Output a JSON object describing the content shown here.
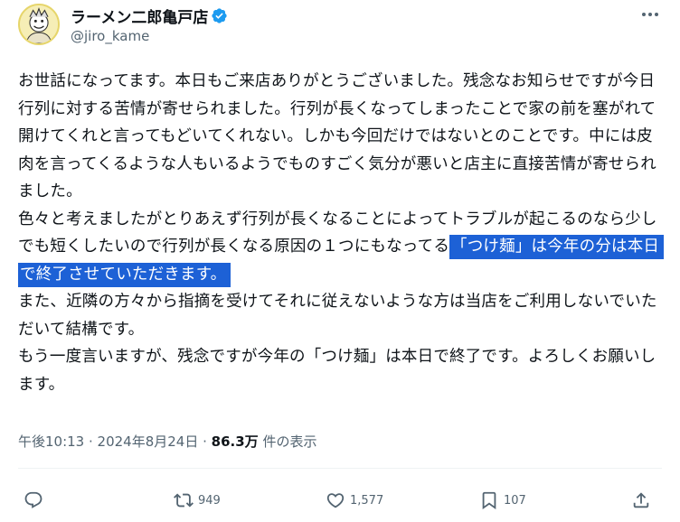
{
  "author": {
    "display_name": "ラーメン二郎亀戸店",
    "handle": "@jiro_kame",
    "verified": true
  },
  "tweet": {
    "text_before": "お世話になってます。本日もご来店ありがとうございました。残念なお知らせですが今日行列に対する苦情が寄せられました。行列が長くなってしまったことで家の前を塞がれて開けてくれと言ってもどいてくれない。しかも今回だけではないとのことです。中には皮肉を言ってくるような人もいるようでものすごく気分が悪いと店主に直接苦情が寄せられました。\n色々と考えましたがとりあえず行列が長くなることによってトラブルが起こるのなら少しでも短くしたいので行列が長くなる原因の１つにもなってる",
    "text_selected": "「つけ麺」は今年の分は本日で終了させていただきます。",
    "text_after": "\nまた、近隣の方々から指摘を受けてそれに従えないような方は当店をご利用しないでいただいて結構です。\nもう一度言いますが、残念ですが今年の「つけ麺」は本日で終了です。よろしくお願いします。"
  },
  "meta": {
    "time": "午後10:13",
    "separator": " · ",
    "date": "2024年8月24日",
    "separator2": " · ",
    "views": "86.3万",
    "views_label": " 件の表示"
  },
  "actions": {
    "reply_icon": "reply-icon",
    "retweet_count": "949",
    "like_count": "1,577",
    "bookmark_count": "107",
    "share_icon": "share-icon"
  },
  "colors": {
    "selection": "#1d61d6",
    "verified": "#1d9bf0",
    "secondary_text": "#536471"
  }
}
